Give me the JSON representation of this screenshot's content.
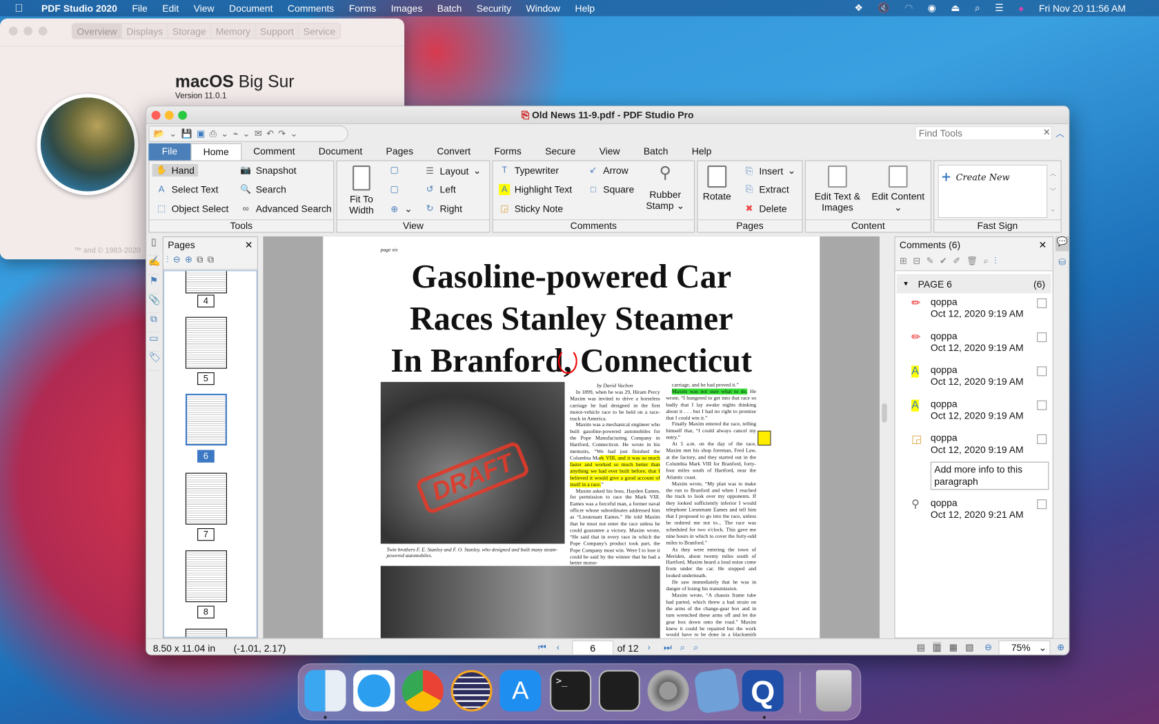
{
  "menubar": {
    "app": "PDF Studio 2020",
    "items": [
      "File",
      "Edit",
      "View",
      "Document",
      "Comments",
      "Forms",
      "Images",
      "Batch",
      "Security",
      "Window",
      "Help"
    ],
    "clock": "Fri Nov 20  11:56 AM"
  },
  "about": {
    "tabs": [
      "Overview",
      "Displays",
      "Storage",
      "Memory",
      "Support",
      "Service"
    ],
    "os_bold": "macOS",
    "os_rest": " Big Sur",
    "version": "Version 11.0.1",
    "copyright": "™ and © 1983-2020"
  },
  "window": {
    "title": "Old News 11-9.pdf - PDF Studio Pro",
    "find_placeholder": "Find Tools"
  },
  "tabs": [
    "File",
    "Home",
    "Comment",
    "Document",
    "Pages",
    "Convert",
    "Forms",
    "Secure",
    "View",
    "Batch",
    "Help"
  ],
  "ribbon": {
    "tools": {
      "label": "Tools",
      "items": [
        "Hand",
        "Select Text",
        "Object Select",
        "Snapshot",
        "Search",
        "Advanced Search"
      ]
    },
    "view": {
      "label": "View",
      "fit": "Fit To Width",
      "items": [
        "Layout",
        "Left",
        "Right"
      ]
    },
    "comments": {
      "label": "Comments",
      "items": [
        "Typewriter",
        "Highlight Text",
        "Sticky Note",
        "Arrow",
        "Square"
      ],
      "stamp": "Rubber Stamp"
    },
    "pages": {
      "label": "Pages",
      "rotate": "Rotate",
      "items": [
        "Insert",
        "Extract",
        "Delete"
      ]
    },
    "content": {
      "label": "Content",
      "edit_text": "Edit Text & Images",
      "edit_content": "Edit Content"
    },
    "fastsign": {
      "label": "Fast Sign",
      "create": "Create New"
    }
  },
  "pages_panel": {
    "title": "Pages",
    "thumbs": [
      "4",
      "5",
      "6",
      "7",
      "8"
    ],
    "selected": "6"
  },
  "document": {
    "page_header": "page six",
    "headline": [
      "Gasoline-powered Car",
      "Races Stanley Steamer",
      "In Branford, Connecticut"
    ],
    "stamp": "DRAFT",
    "caption": "Twin brothers F. E. Stanley and F. O. Stanley, who designed and built many steam-powered automobiles.",
    "byline": "by David Vachon",
    "col1": [
      [
        {
          "t": "In 1899, when he was 29, Hiram Percy Maxim was invited to drive a horseless carriage he had designed in the first motor-vehicle race to be held on a race-track in America."
        }
      ],
      [
        {
          "t": "Maxim was a mechanical engineer who built gasoline-powered automobiles for the Pope Manufacturing Company in Hartford, Connecticut. He wrote in his memoirs, “We had just finished the Columbia Ma"
        },
        {
          "t": "rk VIII, and it was so much faster and worked so much better than anything we had ever built before, that I believed it would give a good account of itself in a race.",
          "h": "y"
        },
        {
          "t": "”"
        }
      ],
      [
        {
          "t": "Maxim asked his boss, Hayden Eames, for permission to race the Mark VIII. Eames was a forceful man, a former naval officer whose subordinates addressed him as “Lieutenant Eames.” He told Maxim that he must not enter the race unless he could guarantee a victory. Maxim wrote, “He said that in every race in which the Pope Company's product took part, the Pope Company must win. Were I to lose it could be said by the winner that he had a better motor-"
        }
      ]
    ],
    "col2": [
      [
        {
          "t": "carriage, and he had proved it.”"
        }
      ],
      [
        {
          "t": "Maxim was not sure what to do.",
          "h": "g"
        },
        {
          "t": " He wrote, “I hungered to get into that race so badly that I lay awake nights thinking about it . . . but I had no right to promise that I could win it.”"
        }
      ],
      [
        {
          "t": "Finally Maxim entered the race, telling himself that, “I could always cancel my entry.”"
        }
      ],
      [
        {
          "t": "At 5 a.m. on the day of the race, Maxim met his shop foreman, Fred Law, at the factory, and they started out in the Columbia Mark VIII for Branford, forty-four miles south of Hartford, near the Atlantic coast."
        }
      ],
      [
        {
          "t": "Maxim wrote, “My plan was to make the run to Branford and when I reached the track to look over my opponents. If they looked sufficiently inferior I would telephone Lieutenant Eames and tell him that I proposed to go into the race, unless he ordered me not to... The race was scheduled for two o'clock. This gave me nine hours in which to cover the forty-odd miles to Branford.”"
        }
      ],
      [
        {
          "t": "As they were entering the town of Meriden, about twenty miles south of Hartford, Maxim heard a loud noise come from under the car. He stopped and looked underneath."
        }
      ],
      [
        {
          "t": "He saw immediately that he was in danger of losing his transmission."
        }
      ],
      [
        {
          "t": "Maxim wrote, “A chassis frame tube had parted, which threw a bad strain on the arms of the change-gear box and in turn wrenched these arms off and let the gear box down onto the road.” Maxim knew it could be repaired but the work would have to be done in a blacksmith shop."
        }
      ]
    ]
  },
  "comments_panel": {
    "title": "Comments (6)",
    "group": "PAGE 6",
    "group_count": "(6)",
    "items": [
      {
        "icon": "pencil-icon",
        "author": "qoppa",
        "date": "Oct 12, 2020 9:19 AM"
      },
      {
        "icon": "pencil-icon",
        "author": "qoppa",
        "date": "Oct 12, 2020 9:19 AM"
      },
      {
        "icon": "highlight-icon",
        "author": "qoppa",
        "date": "Oct 12, 2020 9:19 AM"
      },
      {
        "icon": "highlight-icon",
        "author": "qoppa",
        "date": "Oct 12, 2020 9:19 AM"
      },
      {
        "icon": "sticky-note-icon",
        "author": "qoppa",
        "date": "Oct 12, 2020 9:19 AM",
        "note": "Add more info to this paragraph"
      },
      {
        "icon": "stamp-icon",
        "author": "qoppa",
        "date": "Oct 12, 2020 9:21 AM"
      }
    ]
  },
  "status": {
    "size": "8.50 x 11.04 in",
    "coords": "(-1.01, 2.17)",
    "page": "6",
    "of": "of 12",
    "zoom": "75%"
  },
  "colors": {
    "accent": "#4a7fba",
    "highlight_yellow": "#ffff00",
    "highlight_green": "#33dd33",
    "draft_red": "#e23a2a"
  }
}
